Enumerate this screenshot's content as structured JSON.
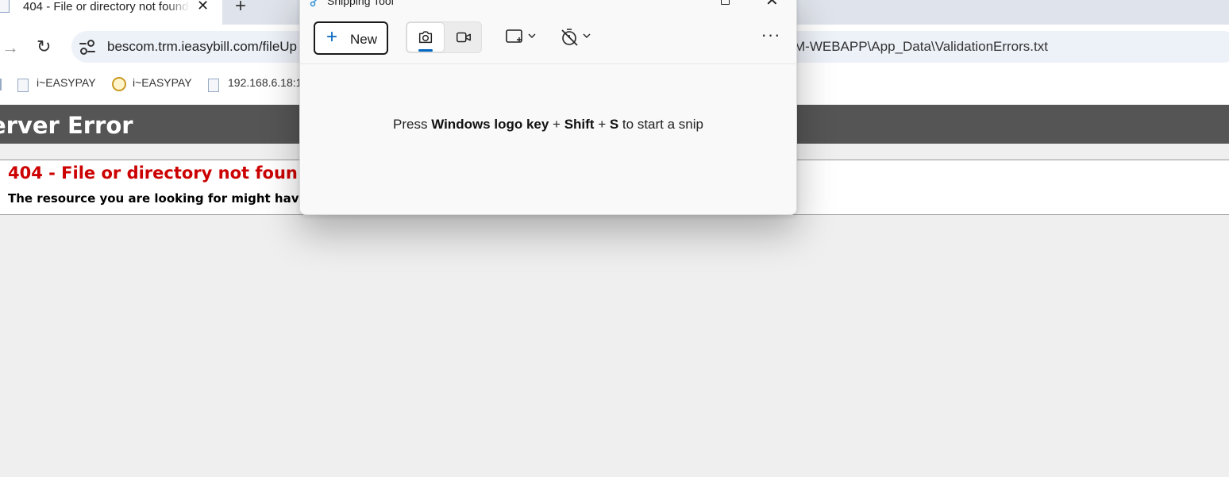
{
  "browser": {
    "tab_title": "404 - File or directory not found.",
    "tab_close": "✕",
    "new_tab": "+",
    "url_left": "bescom.trm.ieasybill.com/fileUp",
    "url_right": "M-WEBAPP\\App_Data\\ValidationErrors.txt",
    "bookmarks": [
      {
        "label": "i~EASYPAY"
      },
      {
        "label": "i~EASYPAY"
      },
      {
        "label": "192.168.6.18:1"
      }
    ]
  },
  "page": {
    "header_title": "erver Error",
    "error_title": "404 - File or directory not foun",
    "error_description": "The resource you are looking for might hav"
  },
  "snipping_tool": {
    "title": "Snipping Tool",
    "new_button": "New",
    "more": "···",
    "hint_prefix": "Press ",
    "hint_keys1": "Windows logo key",
    "hint_plus1": " + ",
    "hint_keys2": "Shift",
    "hint_plus2": " + ",
    "hint_keys3": "S",
    "hint_suffix": " to start a snip",
    "accent_color": "#0067c0"
  }
}
